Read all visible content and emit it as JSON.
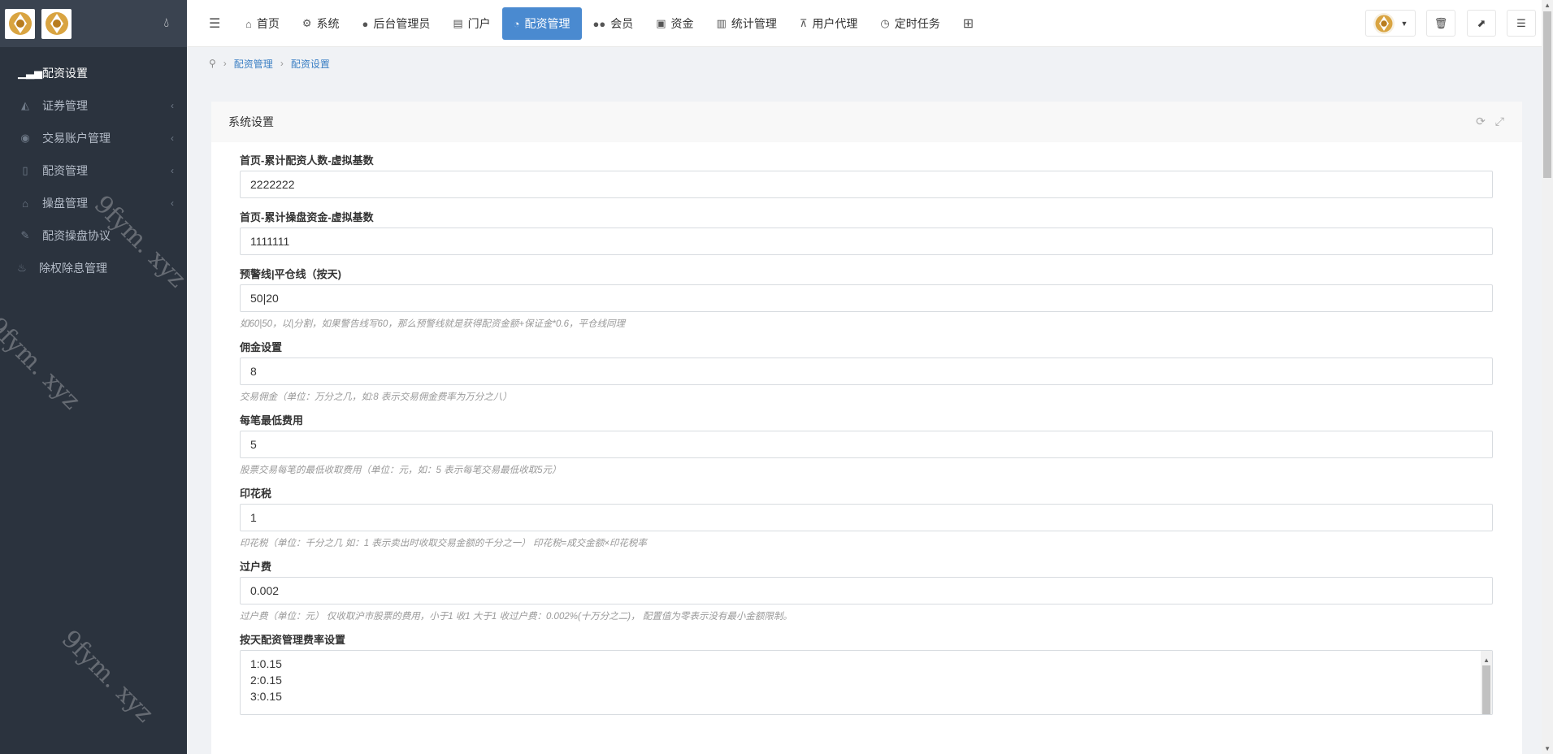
{
  "sidebar": {
    "menu": [
      {
        "label": "配资设置",
        "icon": "signal-icon",
        "has_arrow": false,
        "active": true
      },
      {
        "label": "证券管理",
        "icon": "area-chart-icon",
        "has_arrow": true
      },
      {
        "label": "交易账户管理",
        "icon": "user-circle-icon",
        "has_arrow": true
      },
      {
        "label": "配资管理",
        "icon": "mobile-icon",
        "has_arrow": true
      },
      {
        "label": "操盘管理",
        "icon": "bank-icon",
        "has_arrow": true
      },
      {
        "label": "配资操盘协议",
        "icon": "pencil-icon",
        "has_arrow": false
      },
      {
        "label": "除权除息管理",
        "icon": "fire-extinguisher-icon",
        "has_arrow": false
      }
    ]
  },
  "topbar": {
    "nav": [
      {
        "label": "首页",
        "icon": "home-icon"
      },
      {
        "label": "系统",
        "icon": "cog-icon"
      },
      {
        "label": "后台管理员",
        "icon": "user-icon"
      },
      {
        "label": "门户",
        "icon": "newspaper-icon"
      },
      {
        "label": "配资管理",
        "icon": "pie-chart-icon",
        "active": true
      },
      {
        "label": "会员",
        "icon": "users-icon"
      },
      {
        "label": "资金",
        "icon": "money-icon"
      },
      {
        "label": "统计管理",
        "icon": "bar-chart-icon"
      },
      {
        "label": "用户代理",
        "icon": "sitemap-icon"
      },
      {
        "label": "定时任务",
        "icon": "clock-icon"
      }
    ]
  },
  "breadcrumb": {
    "items": [
      "配资管理",
      "配资设置"
    ]
  },
  "panel": {
    "title": "系统设置",
    "fields": [
      {
        "label": "首页-累计配资人数-虚拟基数",
        "value": "2222222",
        "help": ""
      },
      {
        "label": "首页-累计操盘资金-虚拟基数",
        "value": "1111111",
        "help": ""
      },
      {
        "label": "预警线|平仓线（按天)",
        "value": "50|20",
        "help": "如60|50，以|分割，如果警告线写60，那么预警线就是获得配资金额+保证金*0.6，平仓线同理"
      },
      {
        "label": "佣金设置",
        "value": "8",
        "help": "交易佣金（单位：万分之几，如:8 表示交易佣金费率为万分之八）"
      },
      {
        "label": "每笔最低费用",
        "value": "5",
        "help": "股票交易每笔的最低收取费用（单位：元，如：5 表示每笔交易最低收取5元）"
      },
      {
        "label": "印花税",
        "value": "1",
        "help": "印花税（单位：千分之几 如：1 表示卖出时收取交易金额的千分之一） 印花税=成交金额×印花税率"
      },
      {
        "label": "过户费",
        "value": "0.002",
        "help": "过户费（单位：元） 仅收取沪市股票的费用，小于1 收1 大于1 收过户费：0.002%(十万分之二)， 配置值为零表示没有最小金额限制。"
      }
    ],
    "textarea": {
      "label": "按天配资管理费率设置",
      "lines": [
        "1:0.15",
        "2:0.15",
        "3:0.15"
      ]
    }
  },
  "watermark": "9fym. xyz"
}
